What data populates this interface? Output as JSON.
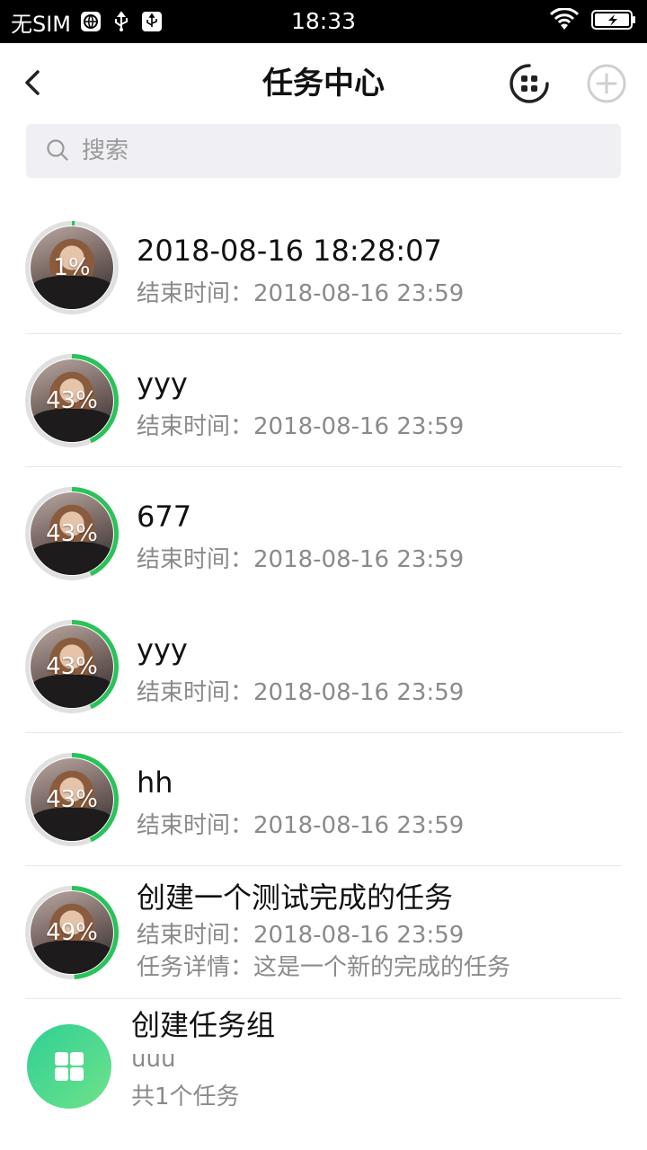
{
  "status_bar": {
    "carrier": "无SIM",
    "time": "18:33"
  },
  "header": {
    "title": "任务中心"
  },
  "search": {
    "placeholder": "搜索"
  },
  "tasks": [
    {
      "percent": "1%",
      "progress": 0.01,
      "title": "2018-08-16 18:28:07",
      "end_time": "结束时间：2018-08-16 23:59"
    },
    {
      "percent": "43%",
      "progress": 0.43,
      "title": "yyy",
      "end_time": "结束时间：2018-08-16 23:59"
    },
    {
      "percent": "43%",
      "progress": 0.43,
      "title": "677",
      "end_time": "结束时间：2018-08-16 23:59"
    },
    {
      "percent": "43%",
      "progress": 0.43,
      "title": "yyy",
      "end_time": "结束时间：2018-08-16 23:59"
    },
    {
      "percent": "43%",
      "progress": 0.43,
      "title": "hh",
      "end_time": "结束时间：2018-08-16 23:59"
    },
    {
      "percent": "49%",
      "progress": 0.49,
      "title": "创建一个测试完成的任务",
      "end_time": "结束时间：2018-08-16 23:59",
      "detail": "任务详情：这是一个新的完成的任务"
    }
  ],
  "group": {
    "title": "创建任务组",
    "subtitle": "uuu",
    "count": "共1个任务"
  },
  "colors": {
    "accent": "#2ac25a",
    "ring_track": "#e0e0e0"
  }
}
